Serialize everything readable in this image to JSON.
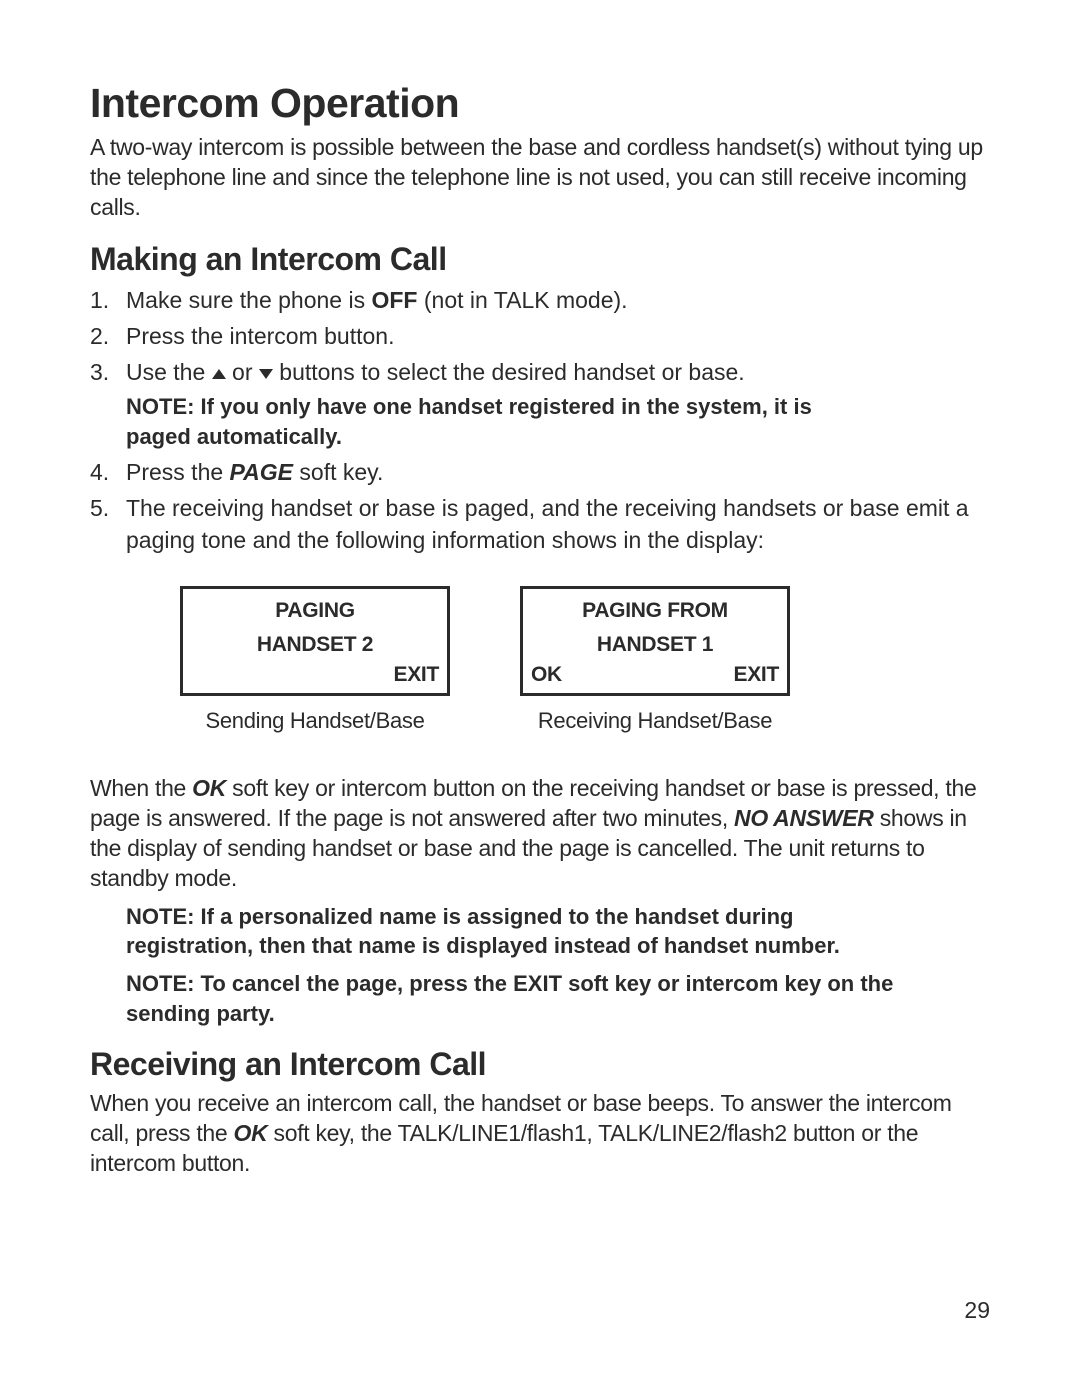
{
  "title": "Intercom Operation",
  "intro": "A two-way intercom is possible between the base and cordless handset(s) without tying up the telephone line and since the telephone line is not used, you can still receive incoming calls.",
  "section1": {
    "heading": "Making an Intercom Call",
    "step1_num": "1.",
    "step1_a": "Make sure the phone is ",
    "step1_b": "OFF",
    "step1_c": " (not in TALK mode).",
    "step2_num": "2.",
    "step2": "Press the intercom button.",
    "step3_num": "3.",
    "step3_a": "Use the ",
    "step3_b": " or ",
    "step3_c": " buttons to select the desired handset or base.",
    "note1": "NOTE: If you only have one handset registered in the system, it is paged automatically.",
    "step4_num": "4.",
    "step4_a": " Press the ",
    "step4_b": "PAGE",
    "step4_c": " soft key.",
    "step5_num": "5.",
    "step5": "The receiving handset or base is paged, and the receiving handsets or base emit a paging tone and the following information shows in the display:"
  },
  "lcd1": {
    "line1": "PAGING",
    "line2": "HANDSET 2",
    "br": "EXIT",
    "caption": "Sending Handset/Base"
  },
  "lcd2": {
    "line1": "PAGING FROM",
    "line2": "HANDSET 1",
    "bl": "OK",
    "br": "EXIT",
    "caption": "Receiving Handset/Base"
  },
  "para2_a": "When the ",
  "para2_b": "OK",
  "para2_c": " soft key or intercom button on the receiving handset or base is pressed, the page is answered. If the page is not answered after two minutes, ",
  "para2_d": "NO ANSWER",
  "para2_e": " shows in the display of sending handset or base and the page is cancelled. The unit returns to standby mode.",
  "note2": "NOTE: If a personalized name is assigned to the handset during registration, then that name is displayed instead of handset number.",
  "note3": "NOTE: To cancel the page, press the EXIT soft key or intercom key on the sending party.",
  "section2": {
    "heading": "Receiving an Intercom Call",
    "body_a": "When you receive an intercom call, the handset or base beeps. To answer the intercom call, press the ",
    "body_b": "OK",
    "body_c": " soft key, the TALK/LINE1/flash1, TALK/LINE2/flash2 button or the intercom button."
  },
  "pagenum": "29"
}
